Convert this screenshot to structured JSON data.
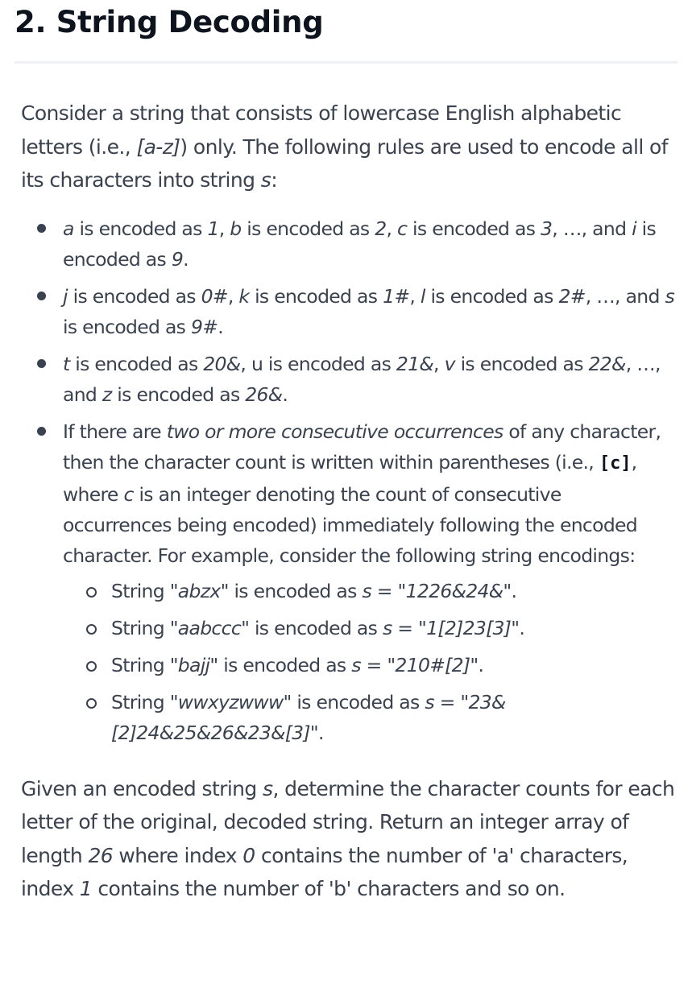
{
  "title": "2. String Decoding",
  "intro": {
    "t1": "Consider a string that consists of lowercase English alphabetic letters (i.e., ",
    "range": "[a-z]",
    "t2": ") only. The following rules are used to encode all of its characters into string ",
    "s": "s",
    "t3": ":"
  },
  "rules": [
    {
      "a": "a",
      "t1": " is encoded as ",
      "v1": "1",
      "t2": ", ",
      "b": "b",
      "t3": " is encoded as ",
      "v2": "2",
      "t4": ", ",
      "c": "c",
      "t5": " is encoded as ",
      "v3": "3",
      "t6": ", …, and ",
      "i": "i",
      "t7": " is encoded as ",
      "v4": "9",
      "t8": "."
    },
    {
      "a": "j",
      "t1": " is encoded as ",
      "v1": "0#",
      "t2": ", ",
      "b": "k",
      "t3": " is encoded as ",
      "v2": "1#",
      "t4": ", ",
      "c": "l",
      "t5": " is encoded as ",
      "v3": "2#",
      "t6": ", …, and ",
      "i": "s",
      "t7": " is encoded as ",
      "v4": "9#",
      "t8": "."
    },
    {
      "a": "t",
      "t1": " is encoded as ",
      "v1": "20&",
      "t2": ", u is encoded as ",
      "v2": "21&",
      "t3": ", ",
      "c": "v",
      "t4": " is encoded as ",
      "v3": "22&",
      "t5": ", …, and ",
      "i": "z",
      "t6": " is encoded as ",
      "v4": "26&",
      "t7": "."
    }
  ],
  "rule4": {
    "t1": "If there are ",
    "em": "two or more consecutive occurrences",
    "t2": " of any character, then the character count is written within parentheses (i.e., ",
    "code": "[c]",
    "t3": ", where ",
    "c": "c",
    "t4": " is an integer denoting the count of consecutive occurrences being encoded) immediately following the encoded character. For example, consider the following string encodings:"
  },
  "examples": [
    {
      "pre": "String ",
      "str": "\"abzx\"",
      "mid": " is encoded as ",
      "s": "s",
      "eq": " = ",
      "enc": "\"1226&24&\"",
      "end": "."
    },
    {
      "pre": "String ",
      "str": "\"aabccc\"",
      "mid": " is encoded as ",
      "s": "s",
      "eq": " = ",
      "enc": "\"1[2]23[3]\"",
      "end": "."
    },
    {
      "pre": "String ",
      "str": "\"bajj\"",
      "mid": " is encoded as ",
      "s": "s",
      "eq": " = ",
      "enc": "\"210#[2]\"",
      "end": "."
    },
    {
      "pre": "String ",
      "str": "\"wwxyzwww\"",
      "mid": " is encoded as ",
      "s": "s",
      "eq": " = ",
      "enc": "\"23& [2]24&25&26&23&[3]\"",
      "end": "."
    }
  ],
  "final": {
    "t1": "Given an encoded string ",
    "s": "s",
    "t2": ", determine the character counts for each letter of the original, decoded string.  Return an integer array of length ",
    "n26": "26",
    "t3": " where index ",
    "n0": "0",
    "t4": " contains the number of 'a' characters, index ",
    "n1": "1",
    "t5": " contains the number of 'b' characters and so on."
  }
}
